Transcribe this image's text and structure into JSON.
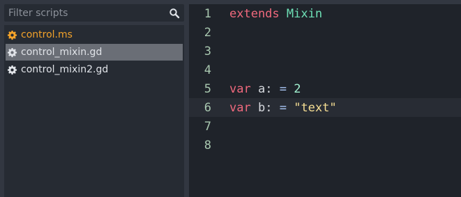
{
  "filter": {
    "placeholder": "Filter scripts",
    "icon": "search-icon"
  },
  "scripts": [
    {
      "name": "control.ms",
      "icon": "gear-icon",
      "state": "modified"
    },
    {
      "name": "control_mixin.gd",
      "icon": "gear-icon",
      "state": "selected"
    },
    {
      "name": "control_mixin2.gd",
      "icon": "gear-icon",
      "state": "normal"
    }
  ],
  "editor": {
    "current_line": 6,
    "lines": [
      {
        "number": "1",
        "tokens": [
          {
            "t": "extends",
            "k": "keyword"
          },
          {
            "t": " ",
            "k": "space"
          },
          {
            "t": "Mixin",
            "k": "type"
          }
        ]
      },
      {
        "number": "2",
        "tokens": []
      },
      {
        "number": "3",
        "tokens": []
      },
      {
        "number": "4",
        "tokens": []
      },
      {
        "number": "5",
        "tokens": [
          {
            "t": "var",
            "k": "keyword"
          },
          {
            "t": " a",
            "k": "ident"
          },
          {
            "t": ":",
            "k": "ident"
          },
          {
            "t": " ",
            "k": "space"
          },
          {
            "t": "=",
            "k": "operator"
          },
          {
            "t": " ",
            "k": "space"
          },
          {
            "t": "2",
            "k": "number"
          }
        ]
      },
      {
        "number": "6",
        "tokens": [
          {
            "t": "var",
            "k": "keyword"
          },
          {
            "t": " b",
            "k": "ident"
          },
          {
            "t": ":",
            "k": "ident"
          },
          {
            "t": " ",
            "k": "space"
          },
          {
            "t": "=",
            "k": "operator"
          },
          {
            "t": " ",
            "k": "space"
          },
          {
            "t": "\"text\"",
            "k": "string"
          }
        ]
      },
      {
        "number": "7",
        "tokens": []
      },
      {
        "number": "8",
        "tokens": []
      }
    ]
  },
  "colors": {
    "background": "#323741",
    "panel": "#262b33",
    "editor_background": "#1f232a",
    "current_line": "#282c34",
    "selected_item": "#6a6e76",
    "modified_text": "#f2a22a",
    "keyword": "#f0697d",
    "type": "#6ee0b6",
    "number": "#a2f2d0",
    "string": "#f7df94",
    "operator": "#a9c6f5",
    "line_number": "#a9c8b0"
  }
}
